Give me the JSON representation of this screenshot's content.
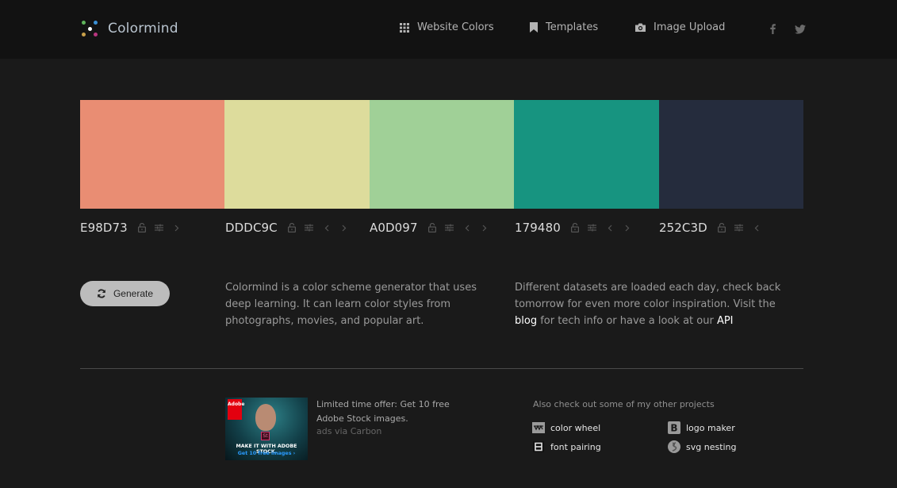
{
  "header": {
    "logo_text": "Colormind",
    "nav": [
      {
        "label": "Website Colors",
        "icon": "grid-icon"
      },
      {
        "label": "Templates",
        "icon": "bookmark-icon"
      },
      {
        "label": "Image Upload",
        "icon": "camera-icon"
      }
    ],
    "social": [
      "facebook-icon",
      "twitter-icon"
    ]
  },
  "palette": {
    "colors": [
      {
        "hex": "E98D73",
        "value": "#E98D73",
        "controls": [
          "lock",
          "adjust",
          "next"
        ]
      },
      {
        "hex": "DDDC9C",
        "value": "#DDDC9C",
        "controls": [
          "lock",
          "adjust",
          "prev",
          "next"
        ]
      },
      {
        "hex": "A0D097",
        "value": "#A0D097",
        "controls": [
          "lock",
          "adjust",
          "prev",
          "next"
        ]
      },
      {
        "hex": "179480",
        "value": "#179480",
        "controls": [
          "lock",
          "adjust",
          "prev",
          "next"
        ]
      },
      {
        "hex": "252C3D",
        "value": "#252C3D",
        "controls": [
          "lock",
          "adjust",
          "prev"
        ]
      }
    ]
  },
  "generate_button": {
    "label": "Generate"
  },
  "description": {
    "left": "Colormind is a color scheme generator that uses deep learning. It can learn color styles from photographs, movies, and popular art.",
    "right_prefix": "Different datasets are loaded each day, check back tomorrow for even more color inspiration. Visit the ",
    "blog_link": "blog",
    "right_middle": " for tech info or have a look at our ",
    "api_link": "API"
  },
  "ad": {
    "image_badge": "Adobe",
    "image_app": "St",
    "image_line1": "MAKE IT WITH ADOBE STOCK.",
    "image_line2": "Get 10 free images ›",
    "text": "Limited time offer: Get 10 free Adobe Stock images.",
    "via": "ads via Carbon"
  },
  "projects": {
    "title": "Also check out some of my other projects",
    "items": [
      {
        "label": "color wheel",
        "icon": "color-wheel-icon"
      },
      {
        "label": "logo maker",
        "icon": "logo-maker-icon"
      },
      {
        "label": "font pairing",
        "icon": "font-pairing-icon"
      },
      {
        "label": "svg nesting",
        "icon": "svg-nesting-icon"
      }
    ]
  }
}
